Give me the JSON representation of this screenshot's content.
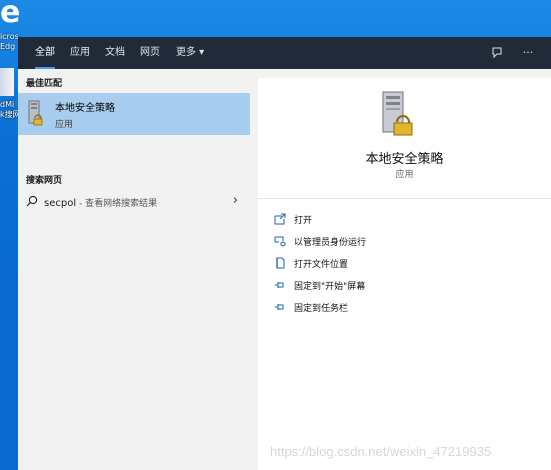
{
  "desktop": {
    "edge_logo": "e",
    "label_lines_1": [
      "icros",
      "Edg"
    ],
    "label_lines_2": [
      "dMi",
      "k搜网"
    ]
  },
  "tabs": [
    {
      "label": "全部",
      "active": true
    },
    {
      "label": "应用",
      "active": false
    },
    {
      "label": "文档",
      "active": false
    },
    {
      "label": "网页",
      "active": false
    },
    {
      "label": "更多 ▾",
      "active": false
    }
  ],
  "top_icons": {
    "feedback": "feedback-icon",
    "more": "···"
  },
  "left": {
    "best_match_header": "最佳匹配",
    "best_match": {
      "title": "本地安全策略",
      "subtitle": "应用"
    },
    "web_header": "搜索网页",
    "web_result": {
      "query": "secpol",
      "suffix": " - 查看网络搜索结果"
    }
  },
  "right": {
    "title": "本地安全策略",
    "subtitle": "应用",
    "actions": [
      {
        "label": "打开",
        "icon": "open-icon"
      },
      {
        "label": "以管理员身份运行",
        "icon": "run-as-admin-icon"
      },
      {
        "label": "打开文件位置",
        "icon": "file-location-icon"
      },
      {
        "label": "固定到\"开始\"屏幕",
        "icon": "pin-start-icon"
      },
      {
        "label": "固定到任务栏",
        "icon": "pin-taskbar-icon"
      }
    ]
  },
  "watermark": "https://blog.csdn.net/weixin_47219935",
  "colors": {
    "topbar": "#202a38",
    "selection": "#a9cdee",
    "panel": "#f2f2f2",
    "accent": "#4c9be8"
  }
}
